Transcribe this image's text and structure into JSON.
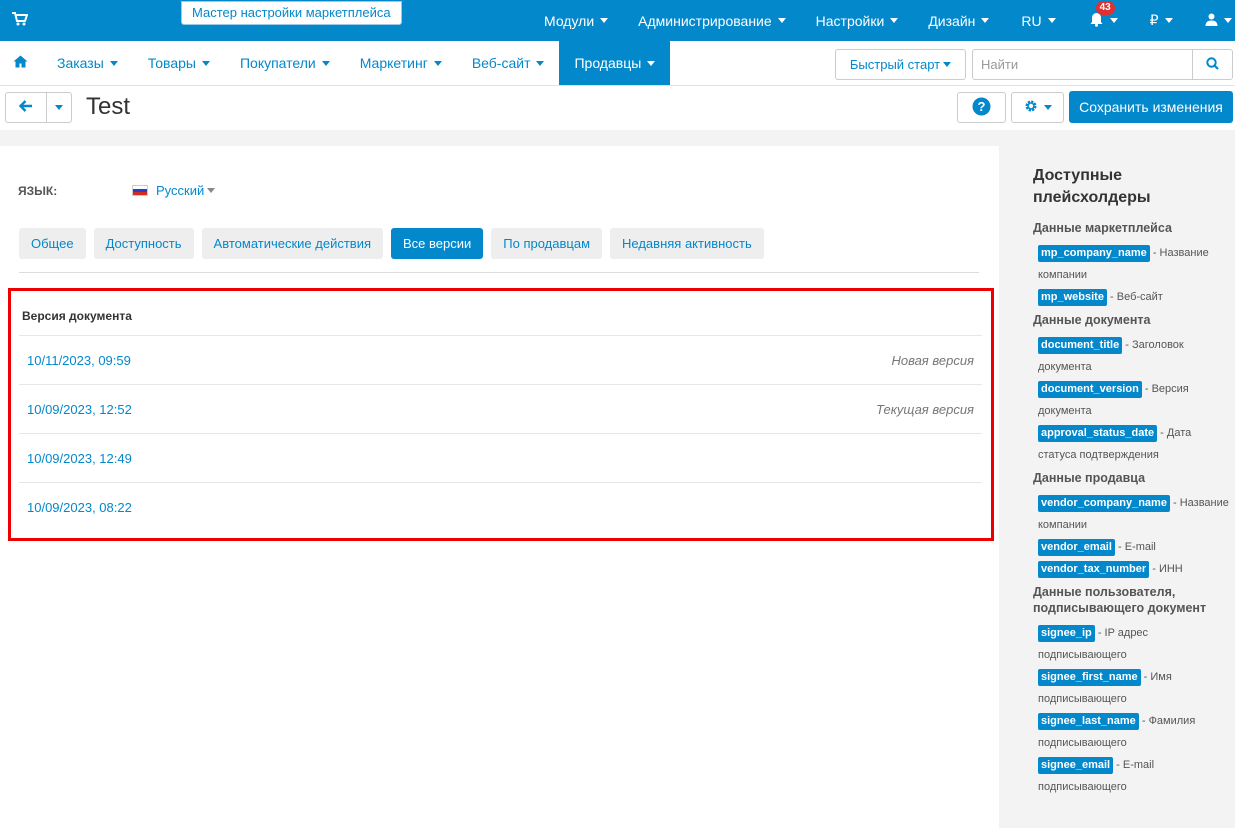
{
  "topbar": {
    "wizard_label": "Мастер настройки маркетплейса",
    "menu": [
      {
        "label": "Модули"
      },
      {
        "label": "Администрирование"
      },
      {
        "label": "Настройки"
      },
      {
        "label": "Дизайн"
      },
      {
        "label": "RU"
      }
    ],
    "notifications_count": "43",
    "currency": "₽"
  },
  "mainnav": {
    "links": [
      "Заказы",
      "Товары",
      "Покупатели",
      "Маркетинг",
      "Веб-сайт",
      "Продавцы"
    ],
    "active_index": 5,
    "quick_start": "Быстрый старт",
    "search_placeholder": "Найти"
  },
  "titlebar": {
    "title": "Test",
    "save_label": "Сохранить изменения"
  },
  "content": {
    "language_label": "ЯЗЫК:",
    "language_value": "Русский",
    "tabs": [
      "Общее",
      "Доступность",
      "Автоматические действия",
      "Все версии",
      "По продавцам",
      "Недавняя активность"
    ],
    "active_tab": 3,
    "table_header": "Версия документа",
    "rows": [
      {
        "date": "10/11/2023, 09:59",
        "note": "Новая версия"
      },
      {
        "date": "10/09/2023, 12:52",
        "note": "Текущая версия"
      },
      {
        "date": "10/09/2023, 12:49",
        "note": ""
      },
      {
        "date": "10/09/2023, 08:22",
        "note": ""
      }
    ]
  },
  "sidebar": {
    "title": "Доступные плейсхолдеры",
    "groups": [
      {
        "title": "Данные маркетплейса",
        "items": [
          {
            "code": "mp_company_name",
            "desc": "- Название компании"
          },
          {
            "code": "mp_website",
            "desc": "- Веб-сайт"
          }
        ]
      },
      {
        "title": "Данные документа",
        "items": [
          {
            "code": "document_title",
            "desc": "- Заголовок документа"
          },
          {
            "code": "document_version",
            "desc": "- Версия документа"
          },
          {
            "code": "approval_status_date",
            "desc": "- Дата статуса подтверждения"
          }
        ]
      },
      {
        "title": "Данные продавца",
        "items": [
          {
            "code": "vendor_company_name",
            "desc": "- Название компании"
          },
          {
            "code": "vendor_email",
            "desc": "- E-mail"
          },
          {
            "code": "vendor_tax_number",
            "desc": "- ИНН"
          }
        ]
      },
      {
        "title": "Данные пользователя, подписывающего документ",
        "items": [
          {
            "code": "signee_ip",
            "desc": "- IP адрес подписывающего"
          },
          {
            "code": "signee_first_name",
            "desc": "- Имя подписывающего"
          },
          {
            "code": "signee_last_name",
            "desc": "- Фамилия подписывающего"
          },
          {
            "code": "signee_email",
            "desc": "- E-mail подписывающего"
          }
        ]
      }
    ]
  },
  "colors": {
    "accent": "#0388cc",
    "highlight": "#ee0000",
    "badge": "#e03030"
  }
}
